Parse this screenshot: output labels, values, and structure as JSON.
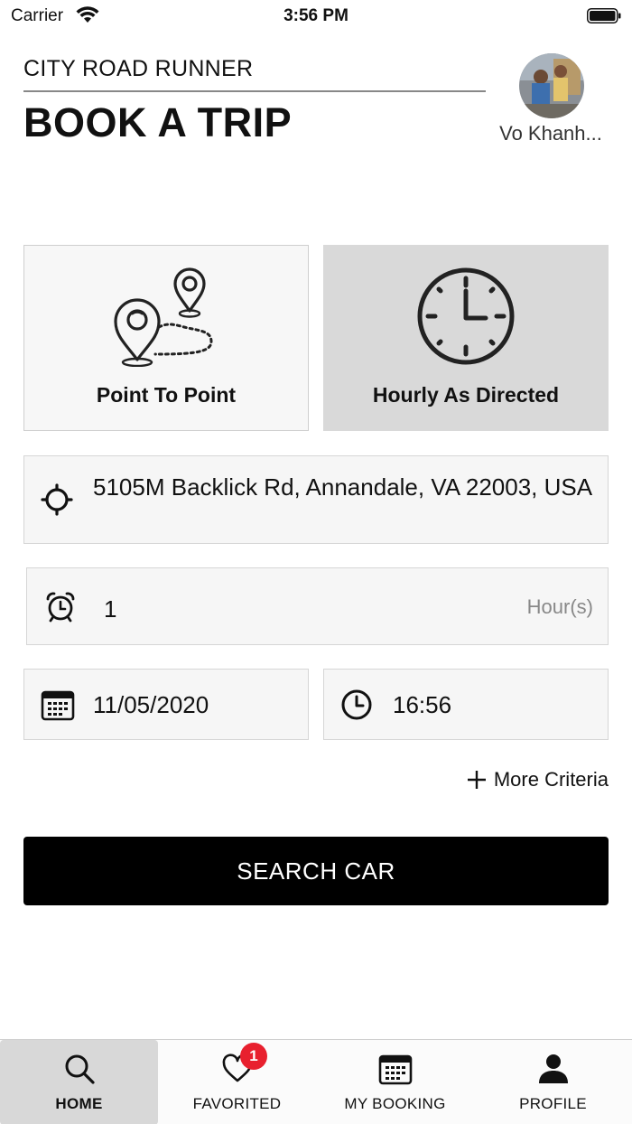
{
  "status_bar": {
    "carrier": "Carrier",
    "time": "3:56 PM"
  },
  "header": {
    "brand": "CITY ROAD RUNNER",
    "title": "BOOK A TRIP",
    "user_name": "Vo Khanh..."
  },
  "trip_types": [
    {
      "label": "Point To Point",
      "icon": "route-pins-icon",
      "selected": false
    },
    {
      "label": "Hourly As Directed",
      "icon": "clock-icon",
      "selected": true
    }
  ],
  "form": {
    "address": "5105M Backlick Rd, Annandale, VA 22003, USA",
    "hours_value": "1",
    "hours_unit": "Hour(s)",
    "date": "11/05/2020",
    "time": "16:56",
    "more_criteria": "More Criteria",
    "search_label": "SEARCH CAR"
  },
  "tab_bar": {
    "items": [
      {
        "label": "HOME",
        "icon": "search-icon",
        "active": true
      },
      {
        "label": "FAVORITED",
        "icon": "heart-icon",
        "active": false,
        "badge": "1"
      },
      {
        "label": "MY BOOKING",
        "icon": "calendar-icon",
        "active": false
      },
      {
        "label": "PROFILE",
        "icon": "person-icon",
        "active": false
      }
    ]
  },
  "colors": {
    "accent": "#000000",
    "badge": "#e8202e",
    "selected_card": "#d9d9d9"
  }
}
